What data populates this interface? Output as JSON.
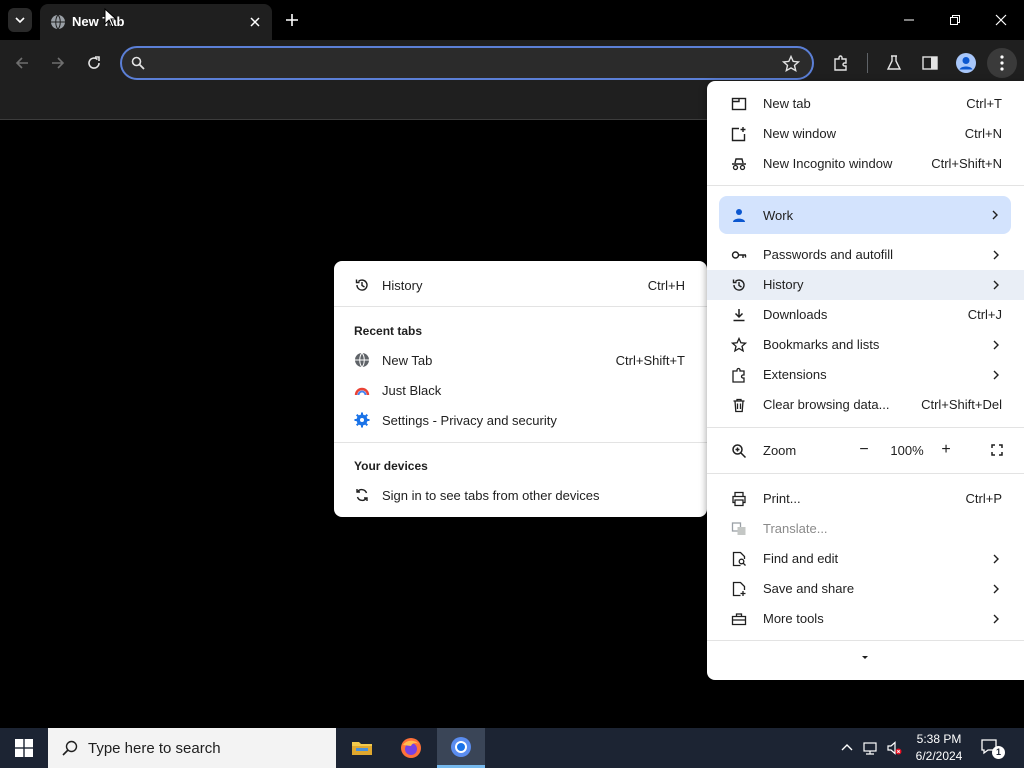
{
  "tab": {
    "title": "New Tab"
  },
  "omnibox": {
    "value": "",
    "placeholder": ""
  },
  "main_menu": {
    "items": [
      {
        "label": "New tab",
        "shortcut": "Ctrl+T",
        "icon": "new-tab-icon"
      },
      {
        "label": "New window",
        "shortcut": "Ctrl+N",
        "icon": "new-window-icon"
      },
      {
        "label": "New Incognito window",
        "shortcut": "Ctrl+Shift+N",
        "icon": "incognito-icon"
      }
    ],
    "profile": {
      "label": "Work",
      "icon": "person-icon"
    },
    "items2": [
      {
        "label": "Passwords and autofill",
        "icon": "key-icon"
      },
      {
        "label": "History",
        "icon": "history-icon"
      },
      {
        "label": "Downloads",
        "shortcut": "Ctrl+J",
        "icon": "download-icon"
      },
      {
        "label": "Bookmarks and lists",
        "icon": "star-icon"
      },
      {
        "label": "Extensions",
        "icon": "puzzle-icon"
      },
      {
        "label": "Clear browsing data...",
        "shortcut": "Ctrl+Shift+Del",
        "icon": "trash-icon"
      }
    ],
    "zoom": {
      "label": "Zoom",
      "value": "100%",
      "minus": "−",
      "plus": "+"
    },
    "items3": [
      {
        "label": "Print...",
        "shortcut": "Ctrl+P",
        "icon": "print-icon"
      },
      {
        "label": "Translate...",
        "icon": "translate-icon"
      },
      {
        "label": "Find and edit",
        "icon": "find-icon"
      },
      {
        "label": "Save and share",
        "icon": "save-icon"
      },
      {
        "label": "More tools",
        "icon": "toolbox-icon"
      }
    ]
  },
  "history_menu": {
    "history": {
      "label": "History",
      "shortcut": "Ctrl+H"
    },
    "recent_heading": "Recent tabs",
    "recent": [
      {
        "label": "New Tab",
        "shortcut": "Ctrl+Shift+T",
        "icon": "globe-icon"
      },
      {
        "label": "Just Black",
        "icon": "just-black-favicon"
      },
      {
        "label": "Settings - Privacy and security",
        "icon": "settings-gear-icon"
      }
    ],
    "devices_heading": "Your devices",
    "devices_item": {
      "label": "Sign in to see tabs from other devices",
      "icon": "sync-icon"
    }
  },
  "taskbar": {
    "search_placeholder": "Type here to search",
    "time": "5:38 PM",
    "date": "6/2/2024",
    "notification_count": "1"
  },
  "colors": {
    "accent": "#0b57d0",
    "highlight": "#d3e3fd",
    "taskbar": "#1c2433"
  }
}
